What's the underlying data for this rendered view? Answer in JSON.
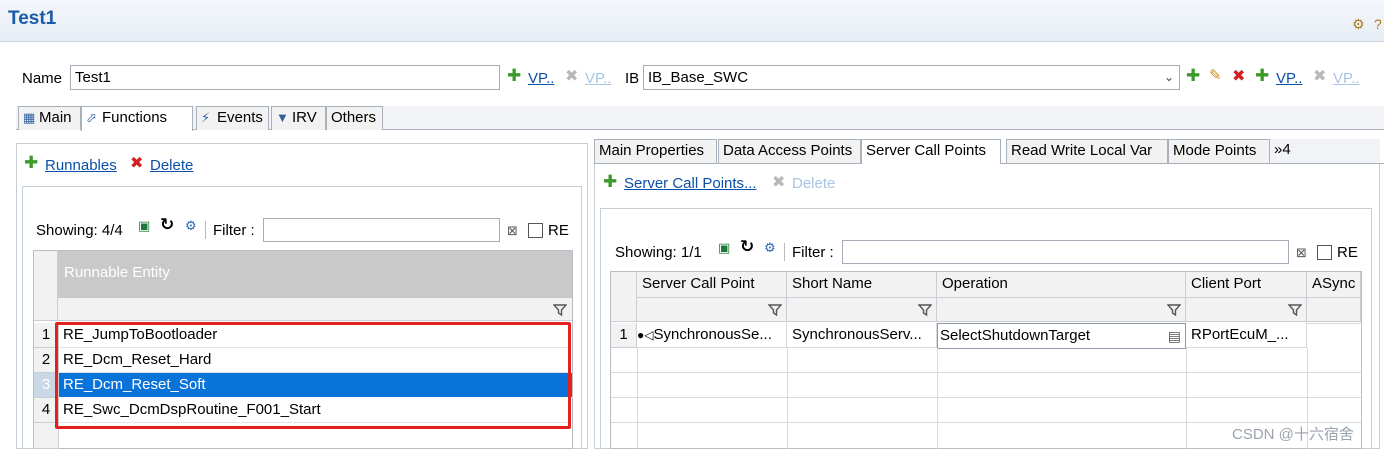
{
  "window": {
    "title": "Test1"
  },
  "form": {
    "name_label": "Name",
    "name_value": "Test1",
    "vp_link_1": "VP..",
    "vp_link_2": "VP..",
    "ib_label": "IB",
    "ib_value": "IB_Base_SWC",
    "vp_link_3": "VP..",
    "vp_link_4": "VP.."
  },
  "main_tabs": [
    {
      "label": "Main",
      "icon": "main-icon"
    },
    {
      "label": "Functions",
      "icon": "functions-icon",
      "active": true
    },
    {
      "label": "Events",
      "icon": "events-icon"
    },
    {
      "label": "IRV",
      "icon": "irv-icon"
    },
    {
      "label": "Others"
    }
  ],
  "left_panel": {
    "add_link": "Runnables",
    "delete_link": "Delete",
    "showing": "Showing: 4/4",
    "filter_label": "Filter :",
    "filter_value": "",
    "re_label": "RE",
    "table": {
      "header": "Runnable Entity",
      "rows": [
        {
          "num": "1",
          "value": "RE_JumpToBootloader"
        },
        {
          "num": "2",
          "value": "RE_Dcm_Reset_Hard"
        },
        {
          "num": "3",
          "value": "RE_Dcm_Reset_Soft",
          "selected": true
        },
        {
          "num": "4",
          "value": "RE_Swc_DcmDspRoutine_F001_Start"
        }
      ]
    }
  },
  "right_tabs": [
    {
      "label": "Main Properties"
    },
    {
      "label": "Data Access Points"
    },
    {
      "label": "Server Call Points",
      "active": true
    },
    {
      "label": "Read Write Local Var"
    },
    {
      "label": "Mode Points"
    },
    {
      "label": "»4"
    }
  ],
  "right_panel": {
    "add_link": "Server Call Points...",
    "delete_link": "Delete",
    "showing": "Showing: 1/1",
    "filter_label": "Filter :",
    "filter_value": "",
    "re_label": "RE",
    "table": {
      "columns": [
        "Server Call Point",
        "Short Name",
        "Operation",
        "Client Port",
        "ASync"
      ],
      "rows": [
        {
          "num": "1",
          "server_call_point": "SynchronousSe...",
          "short_name": "SynchronousServ...",
          "operation": "SelectShutdownTarget",
          "client_port": "RPortEcuM_..."
        }
      ]
    }
  },
  "watermark": "CSDN @十六宿舍",
  "colors": {
    "accent": "#1b5aa8",
    "selection": "#0a73d9",
    "highlight_box": "#e5211d"
  }
}
